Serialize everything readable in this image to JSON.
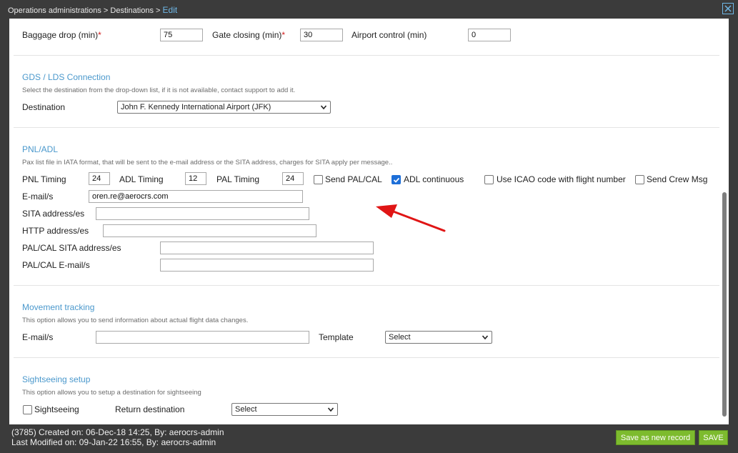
{
  "header": {
    "breadcrumb_1": "Operations administrations",
    "sep_1": ">",
    "breadcrumb_2": "Destinations",
    "sep_2": ">",
    "breadcrumb_3": "Edit"
  },
  "times": {
    "baggage_label": "Baggage drop (min)",
    "baggage_value": "75",
    "gate_label": "Gate closing (min)",
    "gate_value": "30",
    "airport_label": "Airport control (min)",
    "airport_value": "0",
    "required_mark": "*"
  },
  "gds": {
    "title": "GDS / LDS Connection",
    "description": "Select the destination from the drop-down list, if it is not available, contact support to add it.",
    "destination_label": "Destination",
    "destination_value": "John F. Kennedy International Airport (JFK)"
  },
  "pnl": {
    "title": "PNL/ADL",
    "description": "Pax list file in IATA format, that will be sent to the e-mail address or the SITA address, charges for SITA apply per message..",
    "pnl_timing_label": "PNL Timing",
    "pnl_timing_value": "24",
    "adl_timing_label": "ADL Timing",
    "adl_timing_value": "12",
    "pal_timing_label": "PAL Timing",
    "pal_timing_value": "24",
    "send_pal_label": "Send PAL/CAL",
    "send_pal_checked": false,
    "adl_continuous_label": "ADL continuous",
    "adl_continuous_checked": true,
    "icao_label": "Use ICAO code with flight number",
    "icao_checked": false,
    "crew_label": "Send Crew Msg",
    "crew_checked": false,
    "email_label": "E-mail/s",
    "email_value": "oren.re@aerocrs.com",
    "sita_label": "SITA address/es",
    "sita_value": "",
    "http_label": "HTTP address/es",
    "http_value": "",
    "palcal_sita_label": "PAL/CAL SITA address/es",
    "palcal_sita_value": "",
    "palcal_email_label": "PAL/CAL E-mail/s",
    "palcal_email_value": ""
  },
  "movement": {
    "title": "Movement tracking",
    "description": "This option allows you to send information about actual flight data changes.",
    "email_label": "E-mail/s",
    "email_value": "",
    "template_label": "Template",
    "template_value": "Select"
  },
  "sightseeing": {
    "title": "Sightseeing setup",
    "description": "This option allows you to setup a destination for sightseeing",
    "sightseeing_label": "Sightseeing",
    "sightseeing_checked": false,
    "return_label": "Return destination",
    "return_value": "Select"
  },
  "footer": {
    "created": "(3785) Created on: 06-Dec-18 14:25, By: aerocrs-admin",
    "modified": "Last Modified on: 09-Jan-22 16:55, By: aerocrs-admin",
    "save_new_label": "Save as new record",
    "save_label": "SAVE"
  },
  "colors": {
    "accent": "#4a98cc",
    "save_button": "#7dbb2e",
    "annotation_arrow": "#e01515",
    "checkbox_checked": "#1d6fd8"
  },
  "icons": {
    "close": "close-icon",
    "dropdown": "chevron-down-icon",
    "check": "checkmark-icon",
    "annotation": "red-arrow-annotation"
  }
}
